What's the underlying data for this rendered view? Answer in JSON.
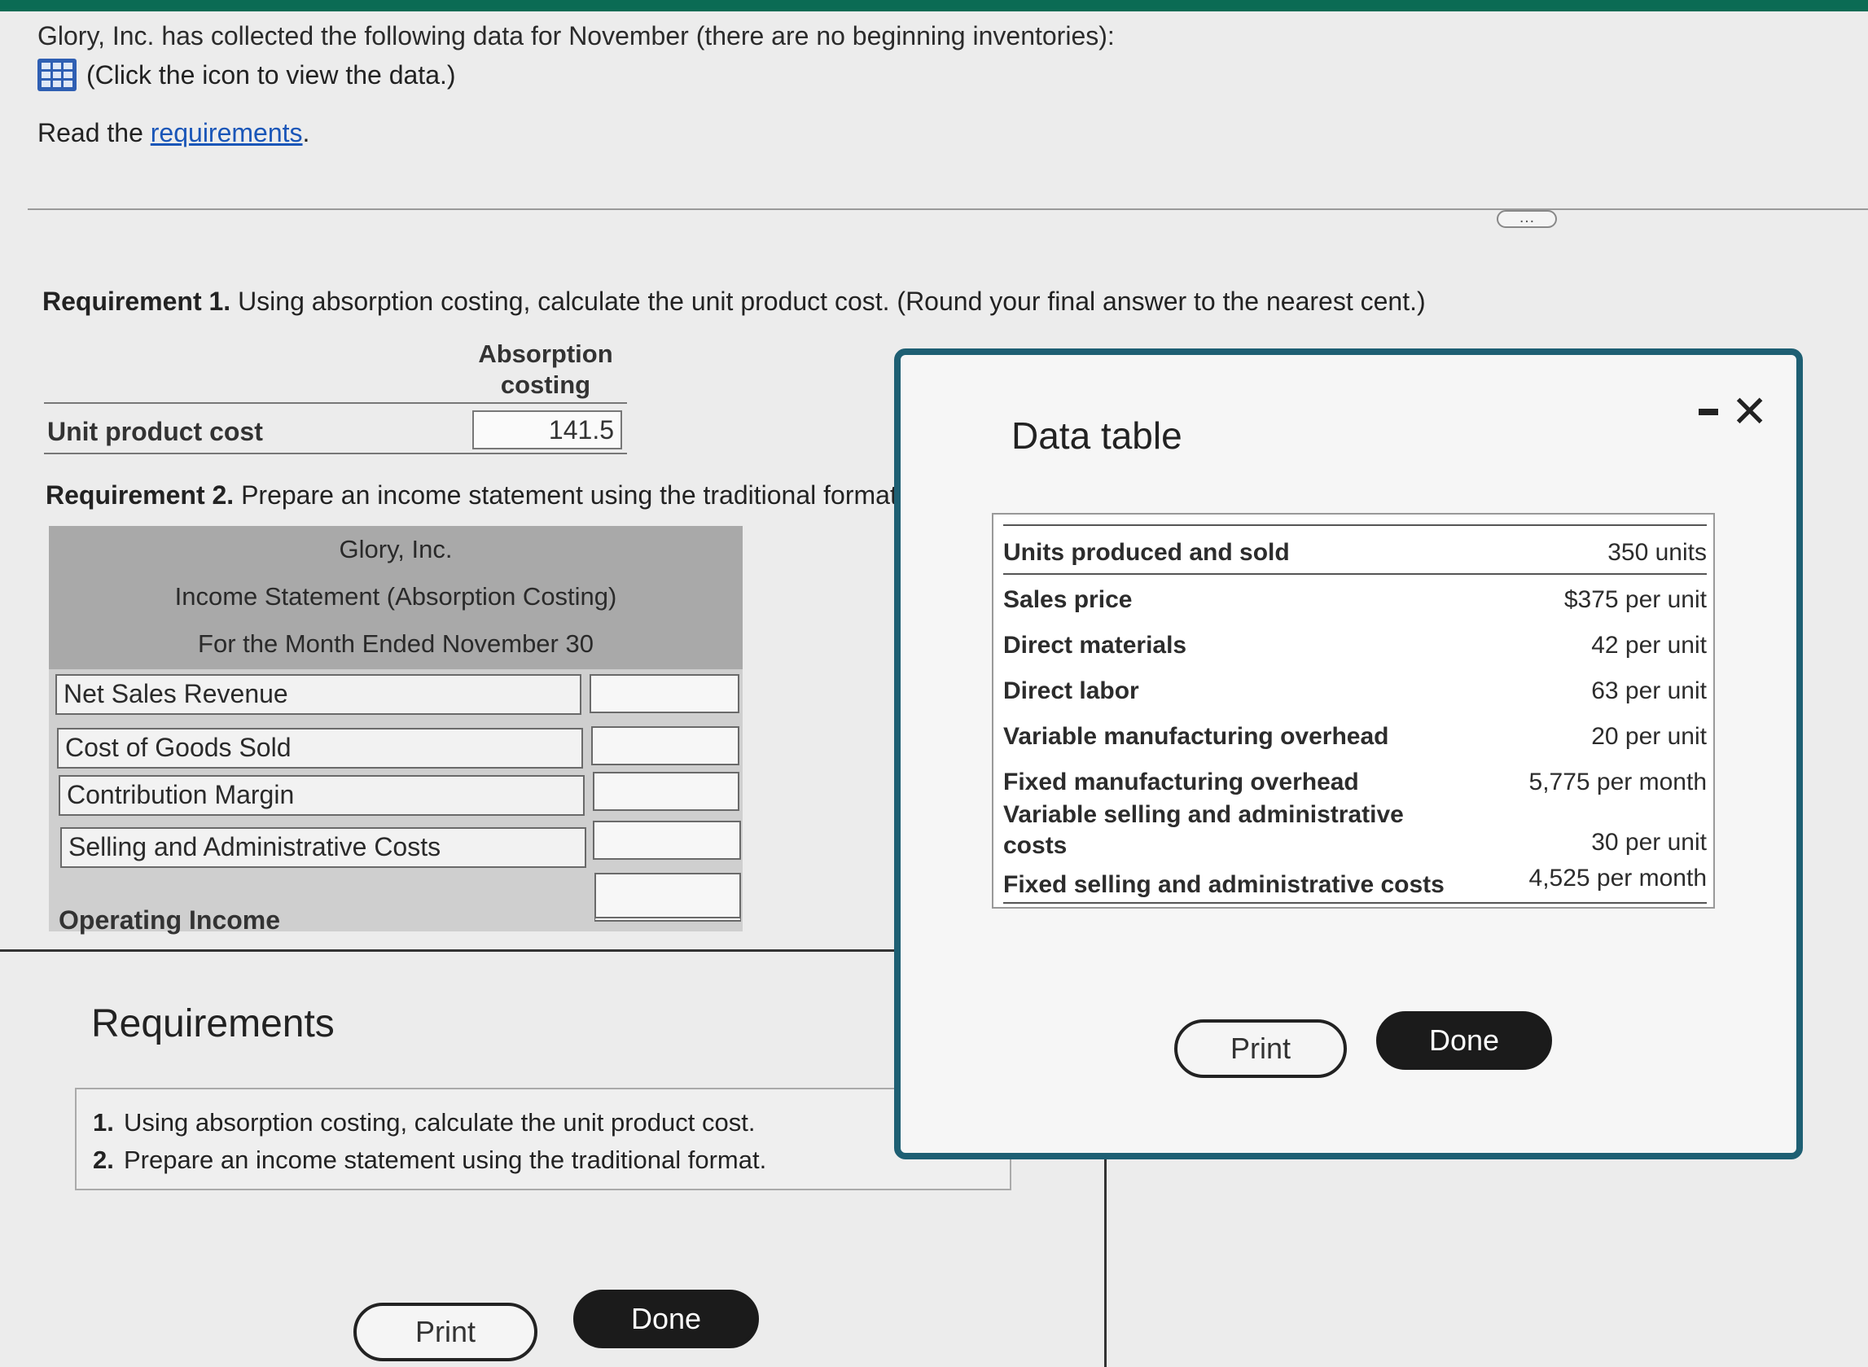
{
  "intro": {
    "text": "Glory, Inc. has collected the following data for November (there are no beginning inventories):",
    "click_text": "(Click the icon to view the data.)",
    "read_prefix": "Read the ",
    "read_link": "requirements",
    "read_suffix": "."
  },
  "more_button": "…",
  "requirement1": {
    "label": "Requirement 1.",
    "text": " Using absorption costing, calculate the unit product cost. (Round your final answer to the nearest cent.)",
    "column_header": "Absorption costing",
    "row_label": "Unit product cost",
    "value": "141.5"
  },
  "requirement2": {
    "label": "Requirement 2.",
    "text": " Prepare an income statement using the traditional format.",
    "statement": {
      "company": "Glory, Inc.",
      "title": "Income Statement (Absorption Costing)",
      "period": "For the Month Ended November 30",
      "rows": [
        "Net Sales Revenue",
        "Cost of Goods Sold",
        "Contribution Margin",
        "Selling and Administrative Costs"
      ],
      "final_row": "Operating Income"
    }
  },
  "requirements_panel": {
    "title": "Requirements",
    "items": [
      {
        "num": "1.",
        "text": "Using absorption costing, calculate the unit product cost."
      },
      {
        "num": "2.",
        "text": "Prepare an income statement using the traditional format."
      }
    ],
    "print": "Print",
    "done": "Done"
  },
  "data_dialog": {
    "title": "Data table",
    "rows": [
      {
        "label": "Units produced and sold",
        "value": "350 units"
      },
      {
        "label": "Sales price",
        "value": "$375 per unit"
      },
      {
        "label": "Direct materials",
        "value": "42 per unit"
      },
      {
        "label": "Direct labor",
        "value": "63 per unit"
      },
      {
        "label": "Variable manufacturing overhead",
        "value": "20 per unit"
      },
      {
        "label": "Fixed manufacturing overhead",
        "value": "5,775 per month"
      },
      {
        "label": "Variable selling and administrative costs",
        "value": "30 per unit"
      },
      {
        "label": "Fixed selling and administrative costs",
        "value": "4,525 per month"
      }
    ],
    "print": "Print",
    "done": "Done",
    "close_icon": "close-icon",
    "minimize_icon": "minimize-icon"
  },
  "colors": {
    "accent_bar": "#0b6b54",
    "dialog_border": "#1e5f73",
    "link": "#1a56b8",
    "done_button": "#1b1b1b"
  }
}
